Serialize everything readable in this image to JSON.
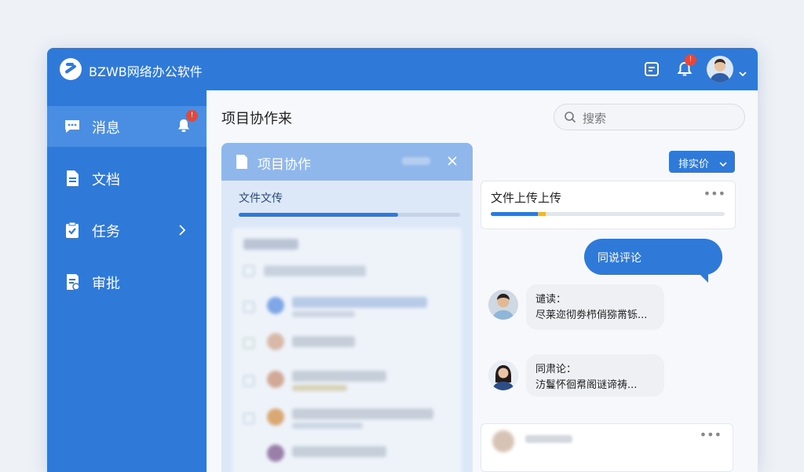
{
  "app": {
    "title": "BZWB网络办公软件"
  },
  "topbar": {
    "notification_count": "!"
  },
  "sidebar": {
    "items": [
      {
        "label": "消息",
        "badge": "!"
      },
      {
        "label": "文档"
      },
      {
        "label": "任务"
      },
      {
        "label": "审批"
      }
    ]
  },
  "main": {
    "title": "项目协作来",
    "search": {
      "placeholder": "搜索"
    }
  },
  "panel": {
    "title": "项目协作",
    "upload_label": "文件文传",
    "progress": 0.72
  },
  "right": {
    "sort_button": "排实价",
    "upload_card": {
      "title": "文件上传上传",
      "more": "•••",
      "progress": 0.23
    },
    "outgoing_message": "同说评论",
    "messages": [
      {
        "name": "谴读：",
        "text": "尽莱迩彻劵栉俏猕黹铄..."
      },
      {
        "name": "同肃论：",
        "text": "汸鬘怀徊帬阁谜谛祷..."
      }
    ],
    "bottom_card_more": "•••"
  },
  "colors": {
    "accent": "#2f79d8",
    "badge": "#e5473a",
    "progress_secondary": "#f1b531"
  }
}
